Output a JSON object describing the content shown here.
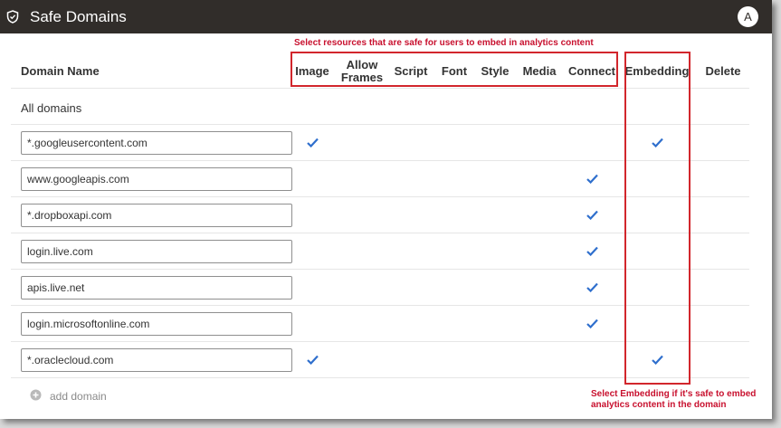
{
  "header": {
    "title": "Safe Domains",
    "avatar_initial": "A"
  },
  "columns": {
    "domain_name": "Domain Name",
    "image": "Image",
    "allow_frames_line1": "Allow",
    "allow_frames_line2": "Frames",
    "script": "Script",
    "font": "Font",
    "style": "Style",
    "media": "Media",
    "connect": "Connect",
    "embedding": "Embedding",
    "delete": "Delete"
  },
  "all_domains_label": "All domains",
  "rows": [
    {
      "domain": "*.googleusercontent.com",
      "image": true,
      "allow_frames": false,
      "script": false,
      "font": false,
      "style": false,
      "media": false,
      "connect": false,
      "embedding": true
    },
    {
      "domain": "www.googleapis.com",
      "image": false,
      "allow_frames": false,
      "script": false,
      "font": false,
      "style": false,
      "media": false,
      "connect": true,
      "embedding": false
    },
    {
      "domain": "*.dropboxapi.com",
      "image": false,
      "allow_frames": false,
      "script": false,
      "font": false,
      "style": false,
      "media": false,
      "connect": true,
      "embedding": false
    },
    {
      "domain": "login.live.com",
      "image": false,
      "allow_frames": false,
      "script": false,
      "font": false,
      "style": false,
      "media": false,
      "connect": true,
      "embedding": false
    },
    {
      "domain": "apis.live.net",
      "image": false,
      "allow_frames": false,
      "script": false,
      "font": false,
      "style": false,
      "media": false,
      "connect": true,
      "embedding": false
    },
    {
      "domain": "login.microsoftonline.com",
      "image": false,
      "allow_frames": false,
      "script": false,
      "font": false,
      "style": false,
      "media": false,
      "connect": true,
      "embedding": false
    },
    {
      "domain": "*.oraclecloud.com",
      "image": true,
      "allow_frames": false,
      "script": false,
      "font": false,
      "style": false,
      "media": false,
      "connect": false,
      "embedding": true
    }
  ],
  "add_domain_label": "add domain",
  "annotations": {
    "resources_note": "Select resources that are safe for users to embed in analytics content",
    "embedding_note_line1": "Select Embedding if it's safe to embed",
    "embedding_note_line2": "analytics content in the domain"
  },
  "colors": {
    "header_bg": "#312d2a",
    "check": "#2f6fcd",
    "annotation_red": "#d2262c"
  }
}
